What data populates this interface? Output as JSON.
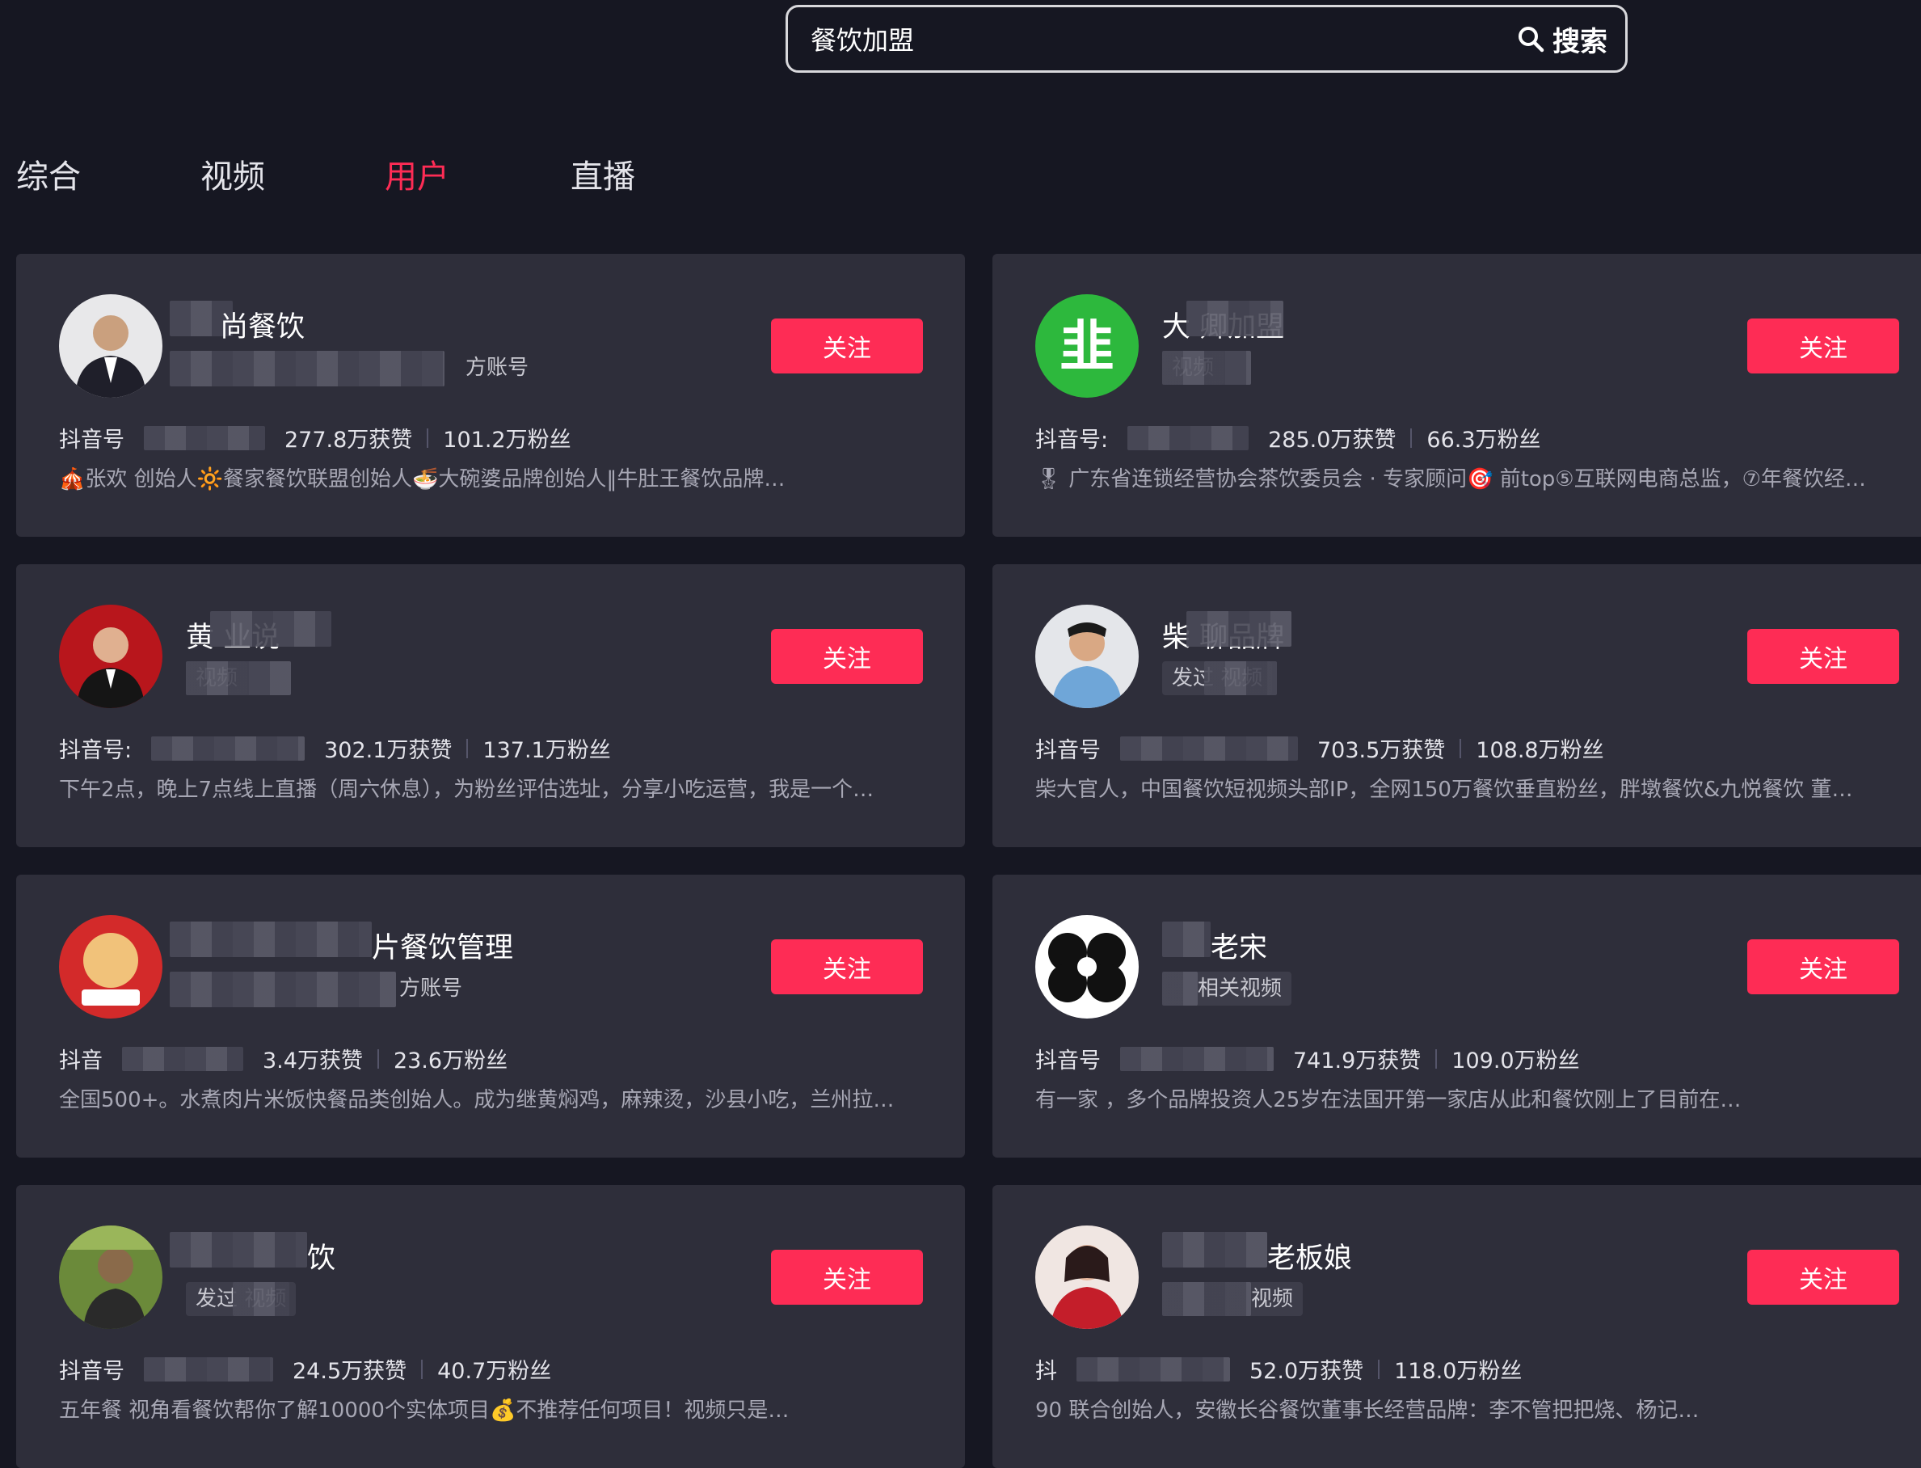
{
  "search": {
    "value": "餐饮加盟",
    "button_label": "搜索",
    "icon": "search-icon"
  },
  "tabs": [
    {
      "label": "综合",
      "active": false
    },
    {
      "label": "视频",
      "active": false
    },
    {
      "label": "用户",
      "active": true
    },
    {
      "label": "直播",
      "active": false
    }
  ],
  "colors": {
    "accent": "#fe2c55",
    "background": "#161722",
    "card": "#2e2e3a"
  },
  "users": [
    {
      "name": "尚餐饮",
      "tag": "方账号",
      "account_label": "抖音号",
      "likes": "277.8万获赞",
      "fans": "101.2万粉丝",
      "desc": "🎪张欢 创始人🔆餐家餐饮联盟创始人🍜大碗婆品牌创始人‖牛肚王餐饮品牌…",
      "follow_label": "关注",
      "avatar": "man-suit-avatar"
    },
    {
      "name": "大 卿加盟",
      "tag": "视频",
      "account_label": "抖音号:",
      "likes": "285.0万获赞",
      "fans": "66.3万粉丝",
      "desc": "🎖 广东省连锁经营协会茶饮委员会 · 专家顾问🎯 前top⑤互联网电商总监，⑦年餐饮经…",
      "follow_label": "关注",
      "avatar": "green-logo-avatar"
    },
    {
      "name": "黄 业说",
      "tag": "视频",
      "account_label": "抖音号:",
      "likes": "302.1万获赞",
      "fans": "137.1万粉丝",
      "desc": "下午2点，晚上7点线上直播（周六休息），为粉丝评估选址，分享小吃运营，我是一个…",
      "follow_label": "关注",
      "avatar": "red-background-avatar"
    },
    {
      "name": "柴 聊品牌",
      "tag": "发过 视频",
      "account_label": "抖音号",
      "likes": "703.5万获赞",
      "fans": "108.8万粉丝",
      "desc": "柴大官人，中国餐饮短视频头部IP，全网150万餐饮垂直粉丝，胖墩餐饮&九悦餐饮 董…",
      "follow_label": "关注",
      "avatar": "blue-shirt-avatar"
    },
    {
      "name": "片餐饮管理",
      "tag": "方账号",
      "account_label": "抖音",
      "likes": "3.4万获赞",
      "fans": "23.6万粉丝",
      "desc": "全国500+。水煮肉片米饭快餐品类创始人。成为继黄焖鸡，麻辣烫，沙县小吃，兰州拉…",
      "follow_label": "关注",
      "avatar": "red-brand-avatar"
    },
    {
      "name": "老宋",
      "tag": "相关视频",
      "account_label": "抖音号",
      "likes": "741.9万获赞",
      "fans": "109.0万粉丝",
      "desc": "有一家 ，多个品牌投资人25岁在法国开第一家店从此和餐饮刚上了目前在…",
      "follow_label": "关注",
      "avatar": "black-white-logo-avatar"
    },
    {
      "name": "饮",
      "tag": "发过 视频",
      "account_label": "抖音号",
      "likes": "24.5万获赞",
      "fans": "40.7万粉丝",
      "desc": "五年餐 视角看餐饮帮你了解10000个实体项目💰不推荐任何项目！视频只是…",
      "follow_label": "关注",
      "avatar": "outdoor-avatar"
    },
    {
      "name": "老板娘",
      "tag": "视频",
      "account_label": "抖",
      "likes": "52.0万获赞",
      "fans": "118.0万粉丝",
      "desc": "90 联合创始人，安徽长谷餐饮董事长经营品牌：李不管把把烧、杨记…",
      "follow_label": "关注",
      "avatar": "woman-red-avatar"
    }
  ]
}
